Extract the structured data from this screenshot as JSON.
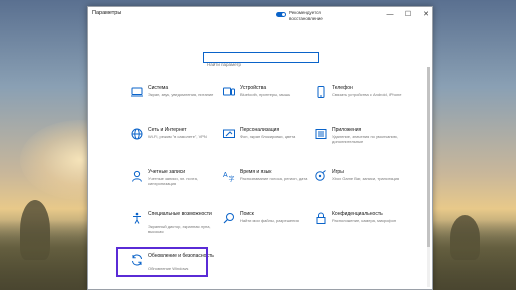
{
  "window": {
    "title": "Параметры",
    "update_status": "Рекомендуется восстановление",
    "minimize_glyph": "—",
    "maximize_glyph": "☐",
    "close_glyph": "✕"
  },
  "search": {
    "placeholder": "Найти параметр"
  },
  "colors": {
    "accent": "#0a63c9",
    "highlight": "#5a2bd6"
  },
  "tiles": [
    {
      "icon": "laptop-icon",
      "name": "Система",
      "desc": "Экран, звук, уведомления, питание"
    },
    {
      "icon": "devices-icon",
      "name": "Устройства",
      "desc": "Bluetooth, принтеры, мышь"
    },
    {
      "icon": "phone-icon",
      "name": "Телефон",
      "desc": "Связать устройства с Android, iPhone"
    },
    {
      "icon": "globe-icon",
      "name": "Сеть и Интернет",
      "desc": "Wi-Fi, режим \"в самолете\", VPN"
    },
    {
      "icon": "personalization-icon",
      "name": "Персонализация",
      "desc": "Фон, экран блокировки, цвета"
    },
    {
      "icon": "apps-icon",
      "name": "Приложения",
      "desc": "Удаление, значения по умолчанию, дополнительные"
    },
    {
      "icon": "person-icon",
      "name": "Учетные записи",
      "desc": "Учетные записи, эл. почта, синхронизация"
    },
    {
      "icon": "time-language-icon",
      "name": "Время и язык",
      "desc": "Распознавание голоса, регион, дата"
    },
    {
      "icon": "gamepad-icon",
      "name": "Игры",
      "desc": "Xbox Game Bar, записи, трансляция"
    },
    {
      "icon": "accessibility-icon",
      "name": "Специальные возможности",
      "desc": "Экранный диктор, экранная лупа, высокая"
    },
    {
      "icon": "search-icon",
      "name": "Поиск",
      "desc": "Найти мои файлы, разрешения"
    },
    {
      "icon": "lock-icon",
      "name": "Конфиденциальность",
      "desc": "Расположение, камера, микрофон"
    },
    {
      "icon": "update-icon",
      "name": "Обновление и безопасность",
      "desc": "Обновление Windows"
    }
  ]
}
